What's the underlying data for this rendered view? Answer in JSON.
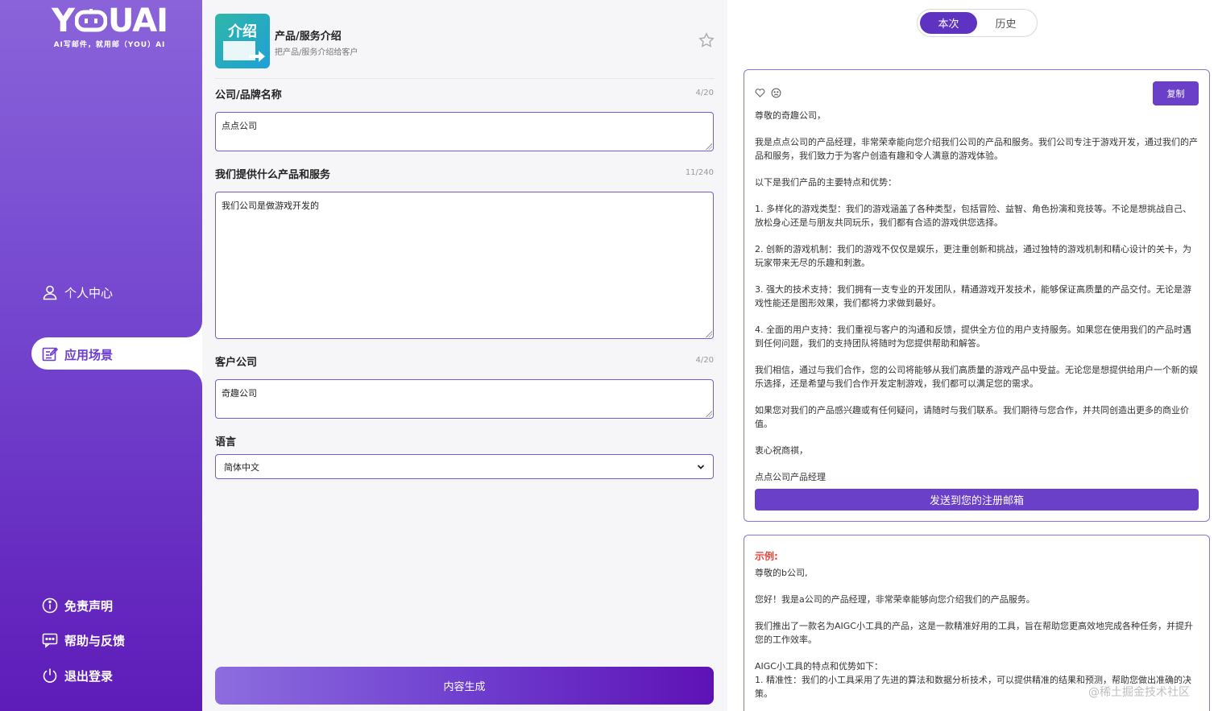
{
  "sidebar": {
    "logo_text": "YOUAI",
    "logo_sub": "AI写邮件，就用邮（YOU）AI",
    "nav_top": [
      {
        "label": "个人中心",
        "icon": "user-icon"
      }
    ],
    "nav_active": {
      "label": "应用场景",
      "icon": "edit-icon"
    },
    "nav_bottom": [
      {
        "label": "免责声明",
        "icon": "info-icon"
      },
      {
        "label": "帮助与反馈",
        "icon": "message-icon"
      },
      {
        "label": "退出登录",
        "icon": "power-icon"
      }
    ]
  },
  "app": {
    "icon_text": "介绍",
    "title": "产品/服务介绍",
    "desc": "把产品/服务介绍给客户"
  },
  "form": {
    "company": {
      "label": "公司/品牌名称",
      "count": "4/20",
      "value": "点点公司"
    },
    "products": {
      "label": "我们提供什么产品和服务",
      "count": "11/240",
      "value": "我们公司是做游戏开发的"
    },
    "client": {
      "label": "客户公司",
      "count": "4/20",
      "value": "奇趣公司"
    },
    "language": {
      "label": "语言",
      "selected": "简体中文"
    },
    "generate_label": "内容生成"
  },
  "tabs": {
    "current": "本次",
    "history": "历史"
  },
  "result": {
    "copy_label": "复制",
    "send_label": "发送到您的注册邮箱",
    "paragraphs": [
      "尊敬的奇趣公司，",
      "我是点点公司的产品经理，非常荣幸能向您介绍我们公司的产品和服务。我们公司专注于游戏开发，通过我们的产品和服务，我们致力于为客户创造有趣和令人满意的游戏体验。",
      "以下是我们产品的主要特点和优势：",
      "1. 多样化的游戏类型：我们的游戏涵盖了各种类型，包括冒险、益智、角色扮演和竞技等。不论是想挑战自己、放松身心还是与朋友共同玩乐，我们都有合适的游戏供您选择。",
      "2. 创新的游戏机制：我们的游戏不仅仅是娱乐，更注重创新和挑战，通过独特的游戏机制和精心设计的关卡，为玩家带来无尽的乐趣和刺激。",
      "3. 强大的技术支持：我们拥有一支专业的开发团队，精通游戏开发技术，能够保证高质量的产品交付。无论是游戏性能还是图形效果，我们都将力求做到最好。",
      "4. 全面的用户支持：我们重视与客户的沟通和反馈，提供全方位的用户支持服务。如果您在使用我们的产品时遇到任何问题，我们的支持团队将随时为您提供帮助和解答。",
      "我们相信，通过与我们合作，您的公司将能够从我们高质量的游戏产品中受益。无论您是想提供给用户一个新的娱乐选择，还是希望与我们合作开发定制游戏，我们都可以满足您的需求。",
      "如果您对我们的产品感兴趣或有任何疑问，请随时与我们联系。我们期待与您合作，并共同创造出更多的商业价值。",
      "衷心祝商祺，",
      "点点公司产品经理"
    ]
  },
  "example": {
    "label": "示例:",
    "p1": "尊敬的b公司,",
    "p2": "您好！我是a公司的产品经理，非常荣幸能够向您介绍我们的产品服务。",
    "p3": "我们推出了一款名为AIGC小工具的产品，这是一款精准好用的工具，旨在帮助您更高效地完成各种任务，并提升您的工作效率。",
    "p4": "AIGC小工具的特点和优势如下：",
    "p5": "1. 精准性：我们的小工具采用了先进的算法和数据分析技术，可以提供精准的结果和预测，帮助您做出准确的决策。"
  },
  "watermark": "@稀土掘金技术社区",
  "colors": {
    "accent": "#6a40c9",
    "sidebar_top": "#8a63d9",
    "sidebar_bottom": "#5e1bb8",
    "example_label": "#e8453c"
  }
}
